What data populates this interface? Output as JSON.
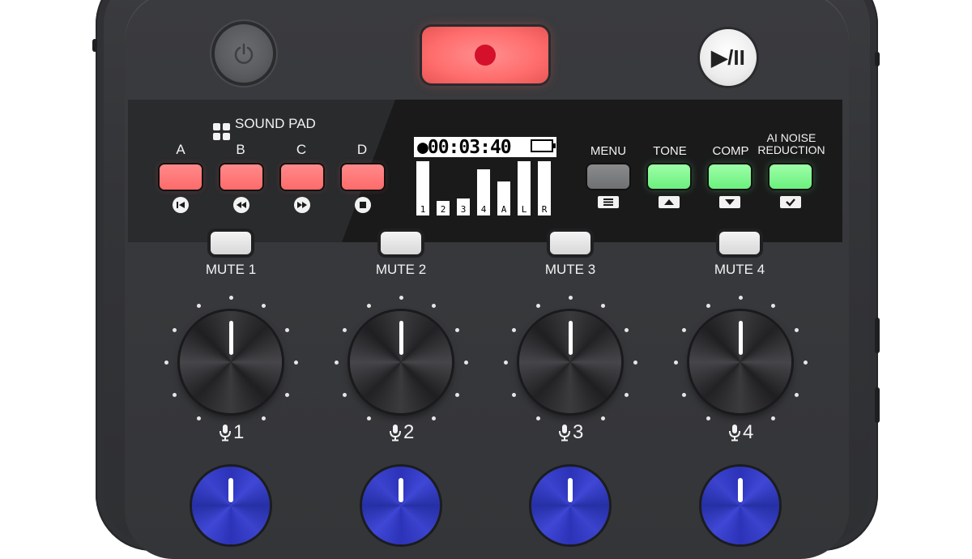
{
  "transport": {
    "power_icon": "power-icon",
    "record_icon": "record-icon",
    "play_pause_label": "▶/II"
  },
  "sound_pad": {
    "title": "SOUND PAD",
    "pads": [
      {
        "label": "A",
        "icon": "skip-back-icon",
        "color": "#ff7474"
      },
      {
        "label": "B",
        "icon": "rewind-icon",
        "color": "#ff7474"
      },
      {
        "label": "C",
        "icon": "fast-forward-icon",
        "color": "#ff7474"
      },
      {
        "label": "D",
        "icon": "stop-icon",
        "color": "#ff7474"
      }
    ]
  },
  "display": {
    "time": "00:03:40",
    "meters": [
      {
        "label": "1",
        "level": 0.95
      },
      {
        "label": "2",
        "level": 0.25
      },
      {
        "label": "3",
        "level": 0.3
      },
      {
        "label": "4",
        "level": 0.82
      },
      {
        "label": "A",
        "level": 0.6
      },
      {
        "label": "L",
        "level": 0.95
      },
      {
        "label": "R",
        "level": 0.95
      }
    ]
  },
  "functions": [
    {
      "label": "MENU",
      "icon": "menu-icon",
      "color": "#7d7e80"
    },
    {
      "label": "TONE",
      "icon": "up-icon",
      "color": "#7ef58f"
    },
    {
      "label": "COMP",
      "icon": "down-icon",
      "color": "#7ef58f"
    },
    {
      "label": "AI NOISE\nREDUCTION",
      "icon": "check-icon",
      "color": "#7ef58f"
    }
  ],
  "channels": [
    {
      "mute_label": "MUTE 1",
      "mic_label": "1"
    },
    {
      "mute_label": "MUTE 2",
      "mic_label": "2"
    },
    {
      "mute_label": "MUTE 3",
      "mic_label": "3"
    },
    {
      "mute_label": "MUTE 4",
      "mic_label": "4"
    }
  ]
}
